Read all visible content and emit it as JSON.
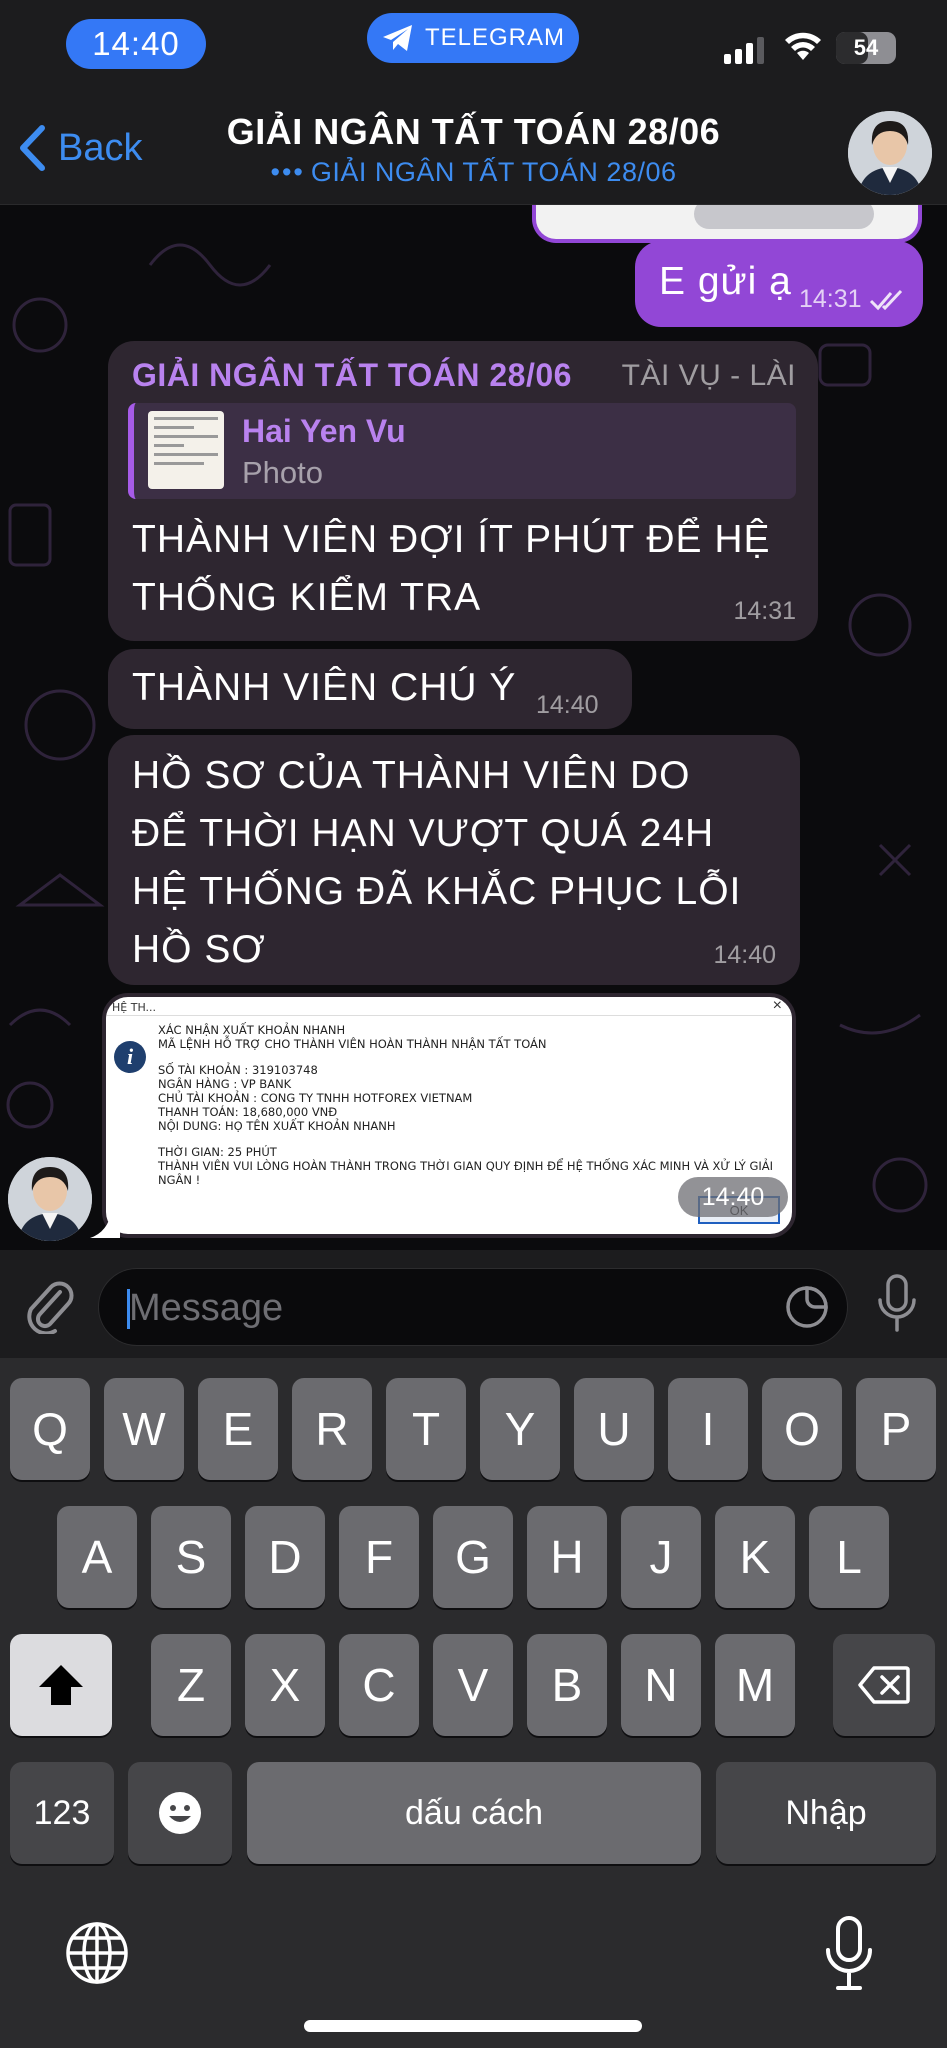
{
  "status_bar": {
    "time": "14:40",
    "app_badge": "TELEGRAM",
    "battery": "54",
    "battery_level": 0.54
  },
  "nav": {
    "back_label": "Back",
    "title": "GIẢI NGÂN TẤT TOÁN 28/06",
    "subtitle": "GIẢI NGÂN TẤT TOÁN 28/06",
    "subtitle_dots": "•••"
  },
  "messages": [
    {
      "direction": "out",
      "text": "E gửi ạ",
      "time": "14:31",
      "status": "read"
    },
    {
      "direction": "in",
      "sender": "GIẢI NGÂN TẤT TOÁN 28/06",
      "role": "TÀI VỤ - LÀI",
      "reply": {
        "name": "Hai Yen Vu",
        "kind": "Photo"
      },
      "text": "THÀNH VIÊN ĐỢI ÍT PHÚT ĐỂ HỆ THỐNG KIỂM TRA",
      "time": "14:31"
    },
    {
      "direction": "in",
      "text": "THÀNH VIÊN CHÚ Ý",
      "time": "14:40"
    },
    {
      "direction": "in",
      "text": "HỒ SƠ CỦA THÀNH VIÊN DO ĐỂ THỜI HẠN VƯỢT QUÁ 24H HỆ THỐNG ĐÃ KHẮC PHỤC LỖI HỒ SƠ",
      "time": "14:40"
    },
    {
      "direction": "in",
      "type": "image",
      "time": "14:40",
      "dialog": {
        "title": "HỆ TH...",
        "close": "×",
        "line1": "XÁC NHẬN XUẤT KHOẢN NHANH",
        "line2": "MÃ LỆNH HỖ TRỢ CHO  THÀNH VIÊN HOÀN THÀNH NHẬN TẤT TOÁN",
        "account": "SỐ TÀI KHOẢN : 319103748",
        "bank": "NGÂN HÀNG : VP BANK",
        "holder": "CHỦ TÀI KHOẢN : CONG TY TNHH HOTFOREX VIETNAM",
        "amount": "THANH TOÁN: 18,680,000  VNĐ",
        "content": "NỘI DUNG: HỌ TÊN XUẤT KHOẢN NHANH",
        "duration": "THỜI GIAN: 25 PHÚT",
        "notice": "THÀNH VIÊN VUI LÒNG HOÀN THÀNH TRONG THỜI GIAN QUY ĐỊNH ĐỂ HỆ THỐNG XÁC MINH VÀ XỬ LÝ GIẢI NGÂN !",
        "ok": "OK"
      }
    }
  ],
  "input": {
    "placeholder": "Message"
  },
  "keyboard": {
    "row1": [
      "Q",
      "W",
      "E",
      "R",
      "T",
      "Y",
      "U",
      "I",
      "O",
      "P"
    ],
    "row2": [
      "A",
      "S",
      "D",
      "F",
      "G",
      "H",
      "J",
      "K",
      "L"
    ],
    "row3": [
      "Z",
      "X",
      "C",
      "V",
      "B",
      "N",
      "M"
    ],
    "numbers": "123",
    "space": "dấu cách",
    "return": "Nhập"
  },
  "colors": {
    "accent": "#3d8cf0",
    "outgoing": "#9247d6",
    "incoming": "#2e2630",
    "sender": "#b982ef"
  },
  "icons": [
    "telegram-icon",
    "signal-icon",
    "wifi-icon",
    "battery-icon",
    "back-chevron-icon",
    "double-check-icon",
    "info-icon",
    "attach-icon",
    "sticker-icon",
    "mic-icon",
    "shift-icon",
    "backspace-icon",
    "emoji-icon",
    "globe-icon"
  ]
}
